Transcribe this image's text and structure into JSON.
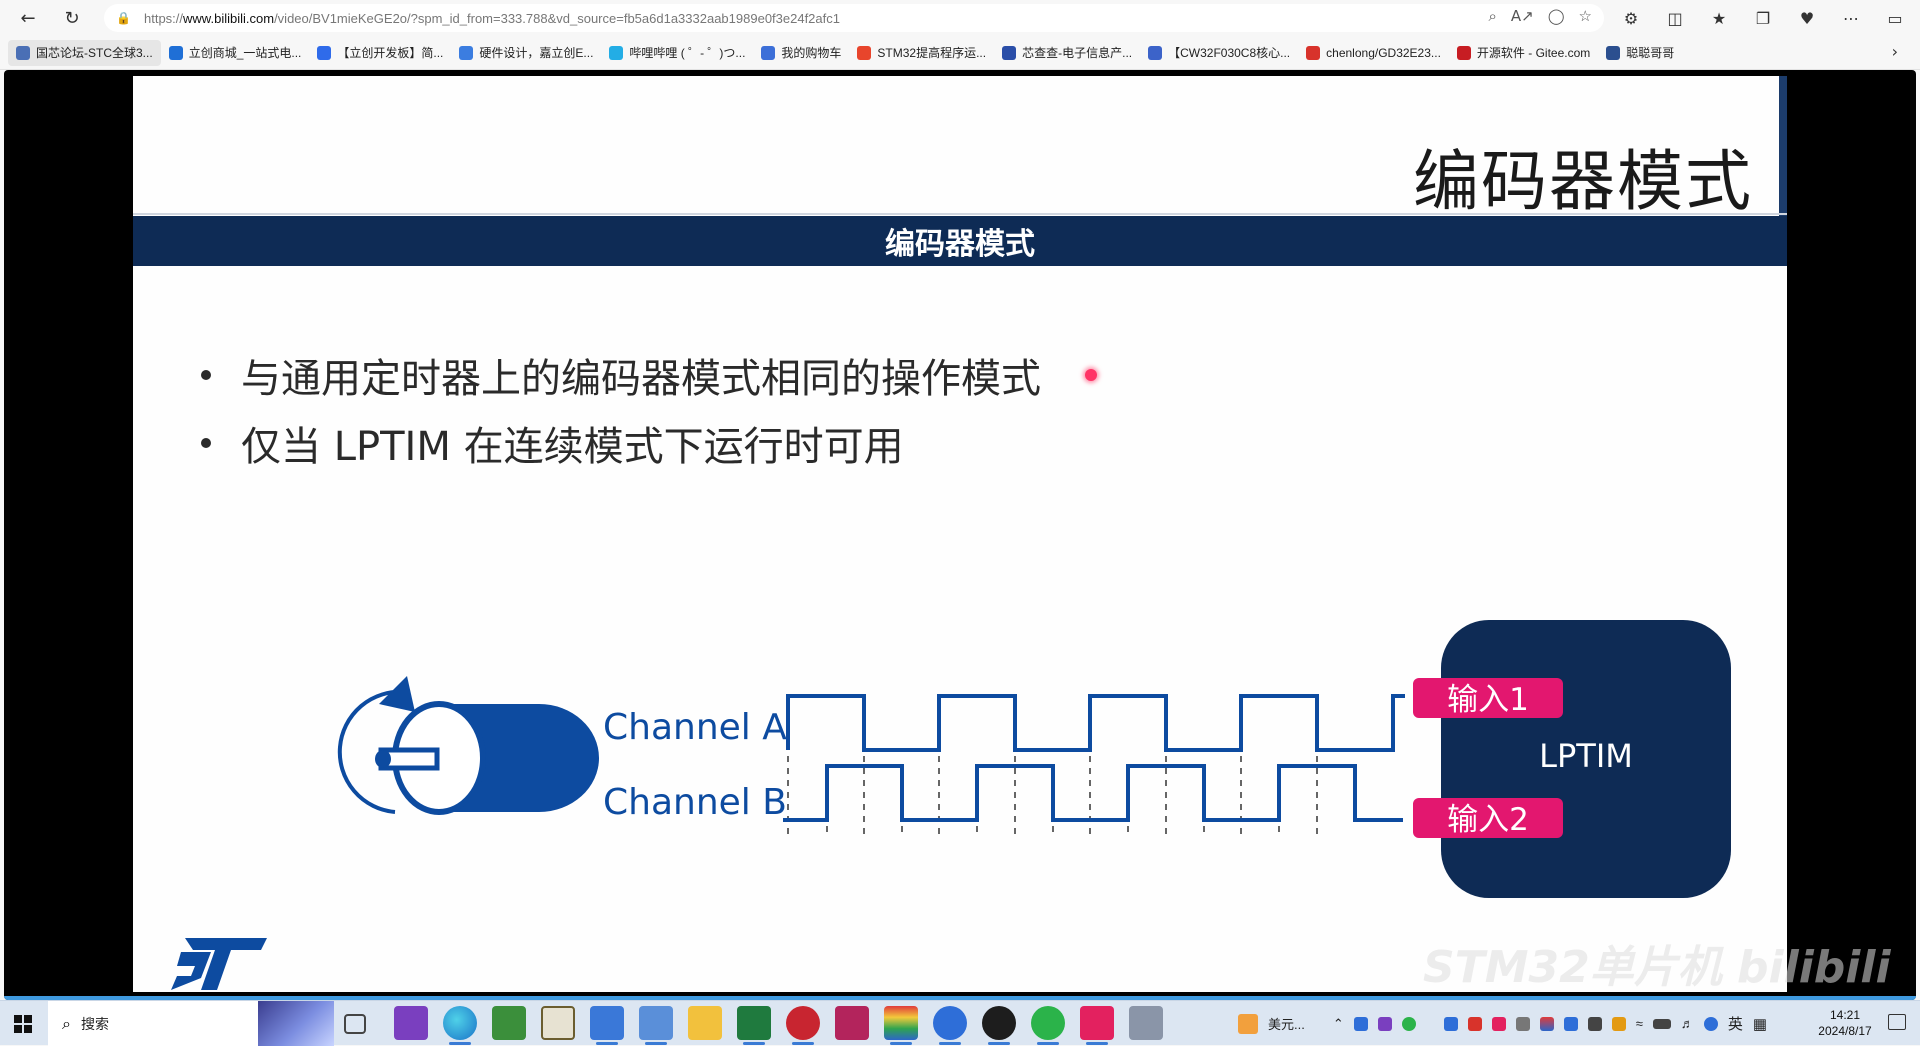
{
  "browser": {
    "url_prefix": "https://",
    "url_domain": "www.bilibili.com",
    "url_path": "/video/BV1mieKeGE2o/?spm_id_from=333.788&vd_source=fb5a6d1a3332aab1989e0f3e24f2afc1"
  },
  "bookmarks": [
    {
      "label": "国芯论坛-STC全球3...",
      "color": "#4a6fb5"
    },
    {
      "label": "立创商城_一站式电...",
      "color": "#1f6fd6"
    },
    {
      "label": "【立创开发板】简...",
      "color": "#2f6bea"
    },
    {
      "label": "硬件设计，嘉立创E...",
      "color": "#3b7de0"
    },
    {
      "label": "哔哩哔哩 ( ゜- ゜)つ...",
      "color": "#23ade5"
    },
    {
      "label": "我的购物车",
      "color": "#3c6fd8"
    },
    {
      "label": "STM32提高程序运...",
      "color": "#e8452c"
    },
    {
      "label": "芯查查-电子信息产...",
      "color": "#2a4ea8"
    },
    {
      "label": "【CW32F030C8核心...",
      "color": "#3c63c9"
    },
    {
      "label": "chenlong/GD32E23...",
      "color": "#d8332b"
    },
    {
      "label": "开源软件 - Gitee.com",
      "color": "#c71d23"
    },
    {
      "label": "聪聪哥哥",
      "color": "#2b4f8f"
    }
  ],
  "slide": {
    "title": "编码器模式",
    "band_title": "编码器模式",
    "bullets": [
      "与通用定时器上的编码器模式相同的操作模式",
      "仅当 LPTIM 在连续模式下运行时可用"
    ],
    "channel_a": "Channel A",
    "channel_b": "Channel B",
    "input1": "输入1",
    "input2": "输入2",
    "block_label": "LPTIM",
    "watermark": "STM32单片机 bilibili"
  },
  "taskbar": {
    "search_placeholder": "搜索",
    "tray_currency": "美元...",
    "ime": "英",
    "time": "14:21",
    "date": "2024/8/17"
  },
  "colors": {
    "navy": "#0e2b55",
    "st_blue": "#0d4ba0",
    "magenta": "#e3176f"
  }
}
